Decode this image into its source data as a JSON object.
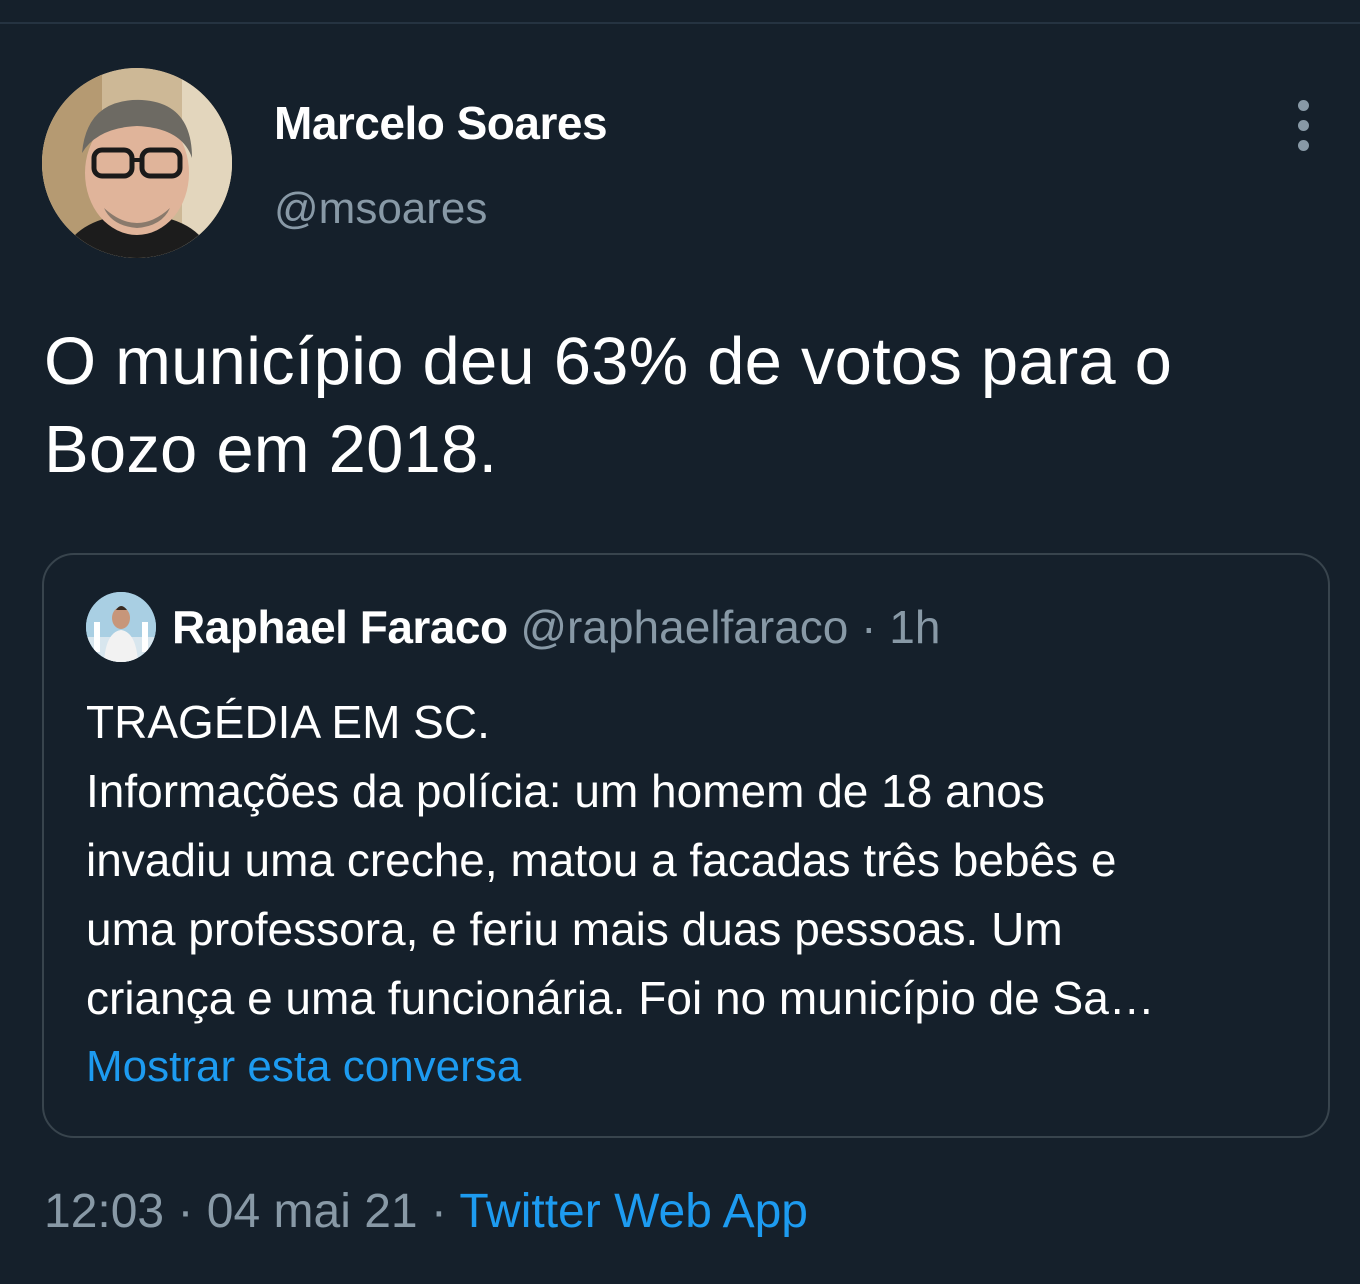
{
  "tweet": {
    "author": {
      "display_name": "Marcelo Soares",
      "handle": "@msoares",
      "avatar_icon": "user-avatar-photo"
    },
    "more_icon": "more-vertical-icon",
    "text_lines": [
      "O município deu 63% de votos para o",
      "Bozo em 2018."
    ],
    "quoted_tweet": {
      "author": {
        "display_name": "Raphael Faraco",
        "handle": "@raphaelfaraco",
        "separator": "·",
        "time": "1h"
      },
      "text_lines": [
        "TRAGÉDIA EM SC.",
        "Informações da polícia: um homem de 18 anos",
        "invadiu uma creche, matou a facadas três bebês e",
        "uma professora, e feriu mais duas pessoas. Um",
        "criança e uma funcionária. Foi no município de Sa…"
      ],
      "show_conversation_label": "Mostrar esta conversa"
    },
    "meta": {
      "time": "12:03",
      "separator_1": " · ",
      "date": "04 mai 21",
      "separator_2": " · ",
      "source": "Twitter Web App"
    }
  },
  "colors": {
    "background": "#15202b",
    "primary_text": "#ffffff",
    "secondary_text": "#8899a6",
    "link": "#1d9bf0",
    "border": "#38444d"
  }
}
